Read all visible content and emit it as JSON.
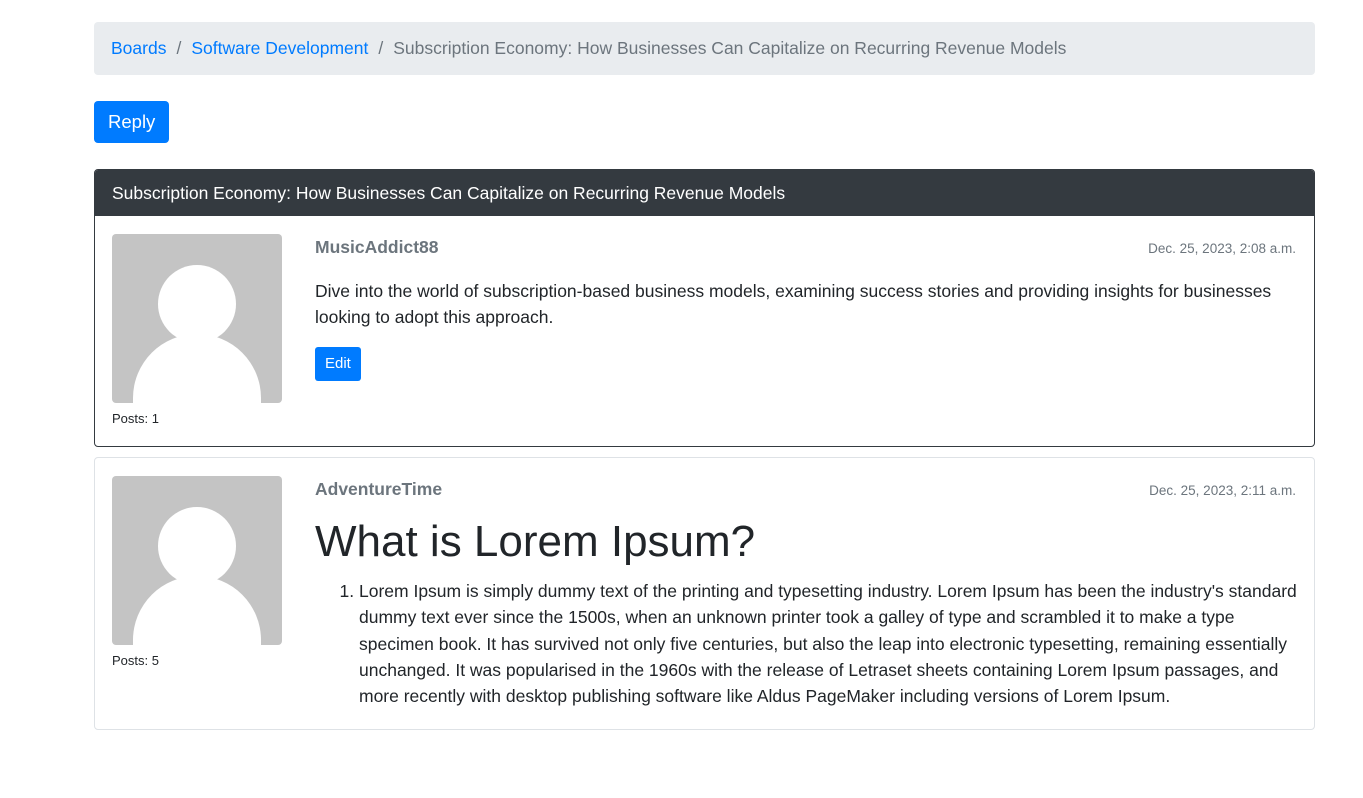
{
  "breadcrumb": {
    "items": [
      "Boards",
      "Software Development"
    ],
    "separator": "/",
    "current": "Subscription Economy: How Businesses Can Capitalize on Recurring Revenue Models"
  },
  "actions": {
    "reply_label": "Reply"
  },
  "thread": {
    "title": "Subscription Economy: How Businesses Can Capitalize on Recurring Revenue Models"
  },
  "posts": [
    {
      "author": "MusicAddict88",
      "date": "Dec. 25, 2023, 2:08 a.m.",
      "post_count": "Posts: 1",
      "body": "Dive into the world of subscription-based business models, examining success stories and providing insights for businesses looking to adopt this approach.",
      "edit_label": "Edit"
    },
    {
      "author": "AdventureTime",
      "date": "Dec. 25, 2023, 2:11 a.m.",
      "post_count": "Posts: 5",
      "heading": "What is Lorem Ipsum?",
      "list_items": [
        "Lorem Ipsum is simply dummy text of the printing and typesetting industry. Lorem Ipsum has been the industry's standard dummy text ever since the 1500s, when an unknown printer took a galley of type and scrambled it to make a type specimen book. It has survived not only five centuries, but also the leap into electronic typesetting, remaining essentially unchanged. It was popularised in the 1960s with the release of Letraset sheets containing Lorem Ipsum passages, and more recently with desktop publishing software like Aldus PageMaker including versions of Lorem Ipsum."
      ]
    }
  ],
  "colors": {
    "accent": "#007bff",
    "header_bg": "#343a40",
    "breadcrumb_bg": "#e9ecef",
    "muted": "#6c757d",
    "avatar_bg": "#c4c4c4"
  }
}
